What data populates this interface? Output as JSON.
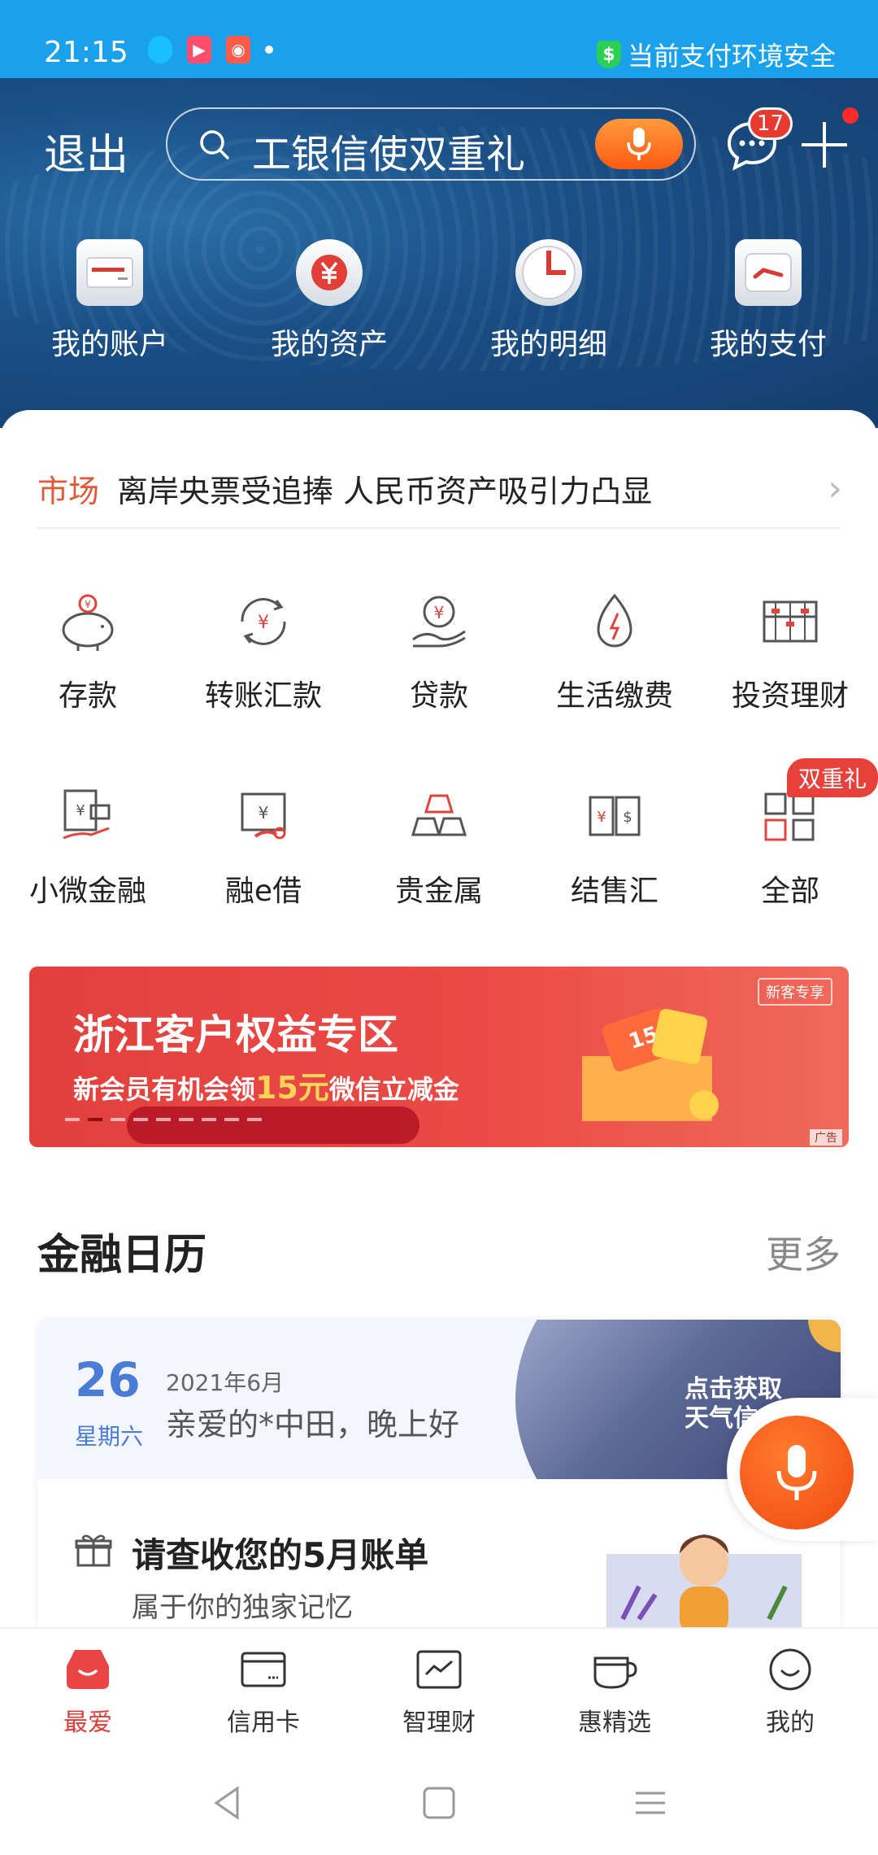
{
  "status_bar": {
    "time": "21:15",
    "safety_text": "当前支付环境安全",
    "shield_symbol": "$"
  },
  "header": {
    "exit_label": "退出",
    "search_text": "工银信使双重礼",
    "message_badge": "17",
    "quick_items": [
      {
        "label": "我的账户",
        "icon": "account-card-icon"
      },
      {
        "label": "我的资产",
        "icon": "assets-yuan-icon"
      },
      {
        "label": "我的明细",
        "icon": "details-clock-icon"
      },
      {
        "label": "我的支付",
        "icon": "payment-icon"
      }
    ]
  },
  "news": {
    "tag": "市场",
    "text": "离岸央票受追捧 人民币资产吸引力凸显"
  },
  "services": [
    {
      "label": "存款",
      "icon": "piggy-bank-icon"
    },
    {
      "label": "转账汇款",
      "icon": "transfer-icon"
    },
    {
      "label": "贷款",
      "icon": "loan-icon"
    },
    {
      "label": "生活缴费",
      "icon": "utility-bill-icon"
    },
    {
      "label": "投资理财",
      "icon": "abacus-icon"
    },
    {
      "label": "小微金融",
      "icon": "micro-finance-icon"
    },
    {
      "label": "融e借",
      "icon": "e-loan-icon"
    },
    {
      "label": "贵金属",
      "icon": "gold-bars-icon"
    },
    {
      "label": "结售汇",
      "icon": "currency-exchange-icon"
    },
    {
      "label": "全部",
      "icon": "all-grid-icon",
      "badge": "双重礼"
    }
  ],
  "banner": {
    "title": "浙江客户权益专区",
    "subtitle_prefix": "新会员有机会领",
    "subtitle_highlight": "15元",
    "subtitle_suffix": "微信立减金",
    "corner_tag": "新客专享",
    "ad_label": "广告",
    "coupon_number": "15",
    "active_slide": 2,
    "slide_count": 9
  },
  "calendar": {
    "title": "金融日历",
    "more_label": "更多",
    "day": "26",
    "weekday": "星期六",
    "month": "2021年6月",
    "greeting": "亲爱的*中田，晚上好",
    "weather_line1": "点击获取",
    "weather_line2": "天气信",
    "bill_title": "请查收您的5月账单",
    "bill_subtitle": "属于你的独家记忆"
  },
  "tabs": [
    {
      "label": "最爱",
      "icon": "favorite-icon",
      "active": true
    },
    {
      "label": "信用卡",
      "icon": "credit-card-icon",
      "active": false
    },
    {
      "label": "智理财",
      "icon": "smart-finance-icon",
      "active": false
    },
    {
      "label": "惠精选",
      "icon": "coffee-cup-icon",
      "active": false
    },
    {
      "label": "我的",
      "icon": "smile-profile-icon",
      "active": false
    }
  ],
  "colors": {
    "status_bar": "#1aa1ec",
    "header": "#1a4f85",
    "accent_red": "#e03c37",
    "news_tag": "#e05a3a",
    "calendar_blue": "#4a7bd6"
  }
}
